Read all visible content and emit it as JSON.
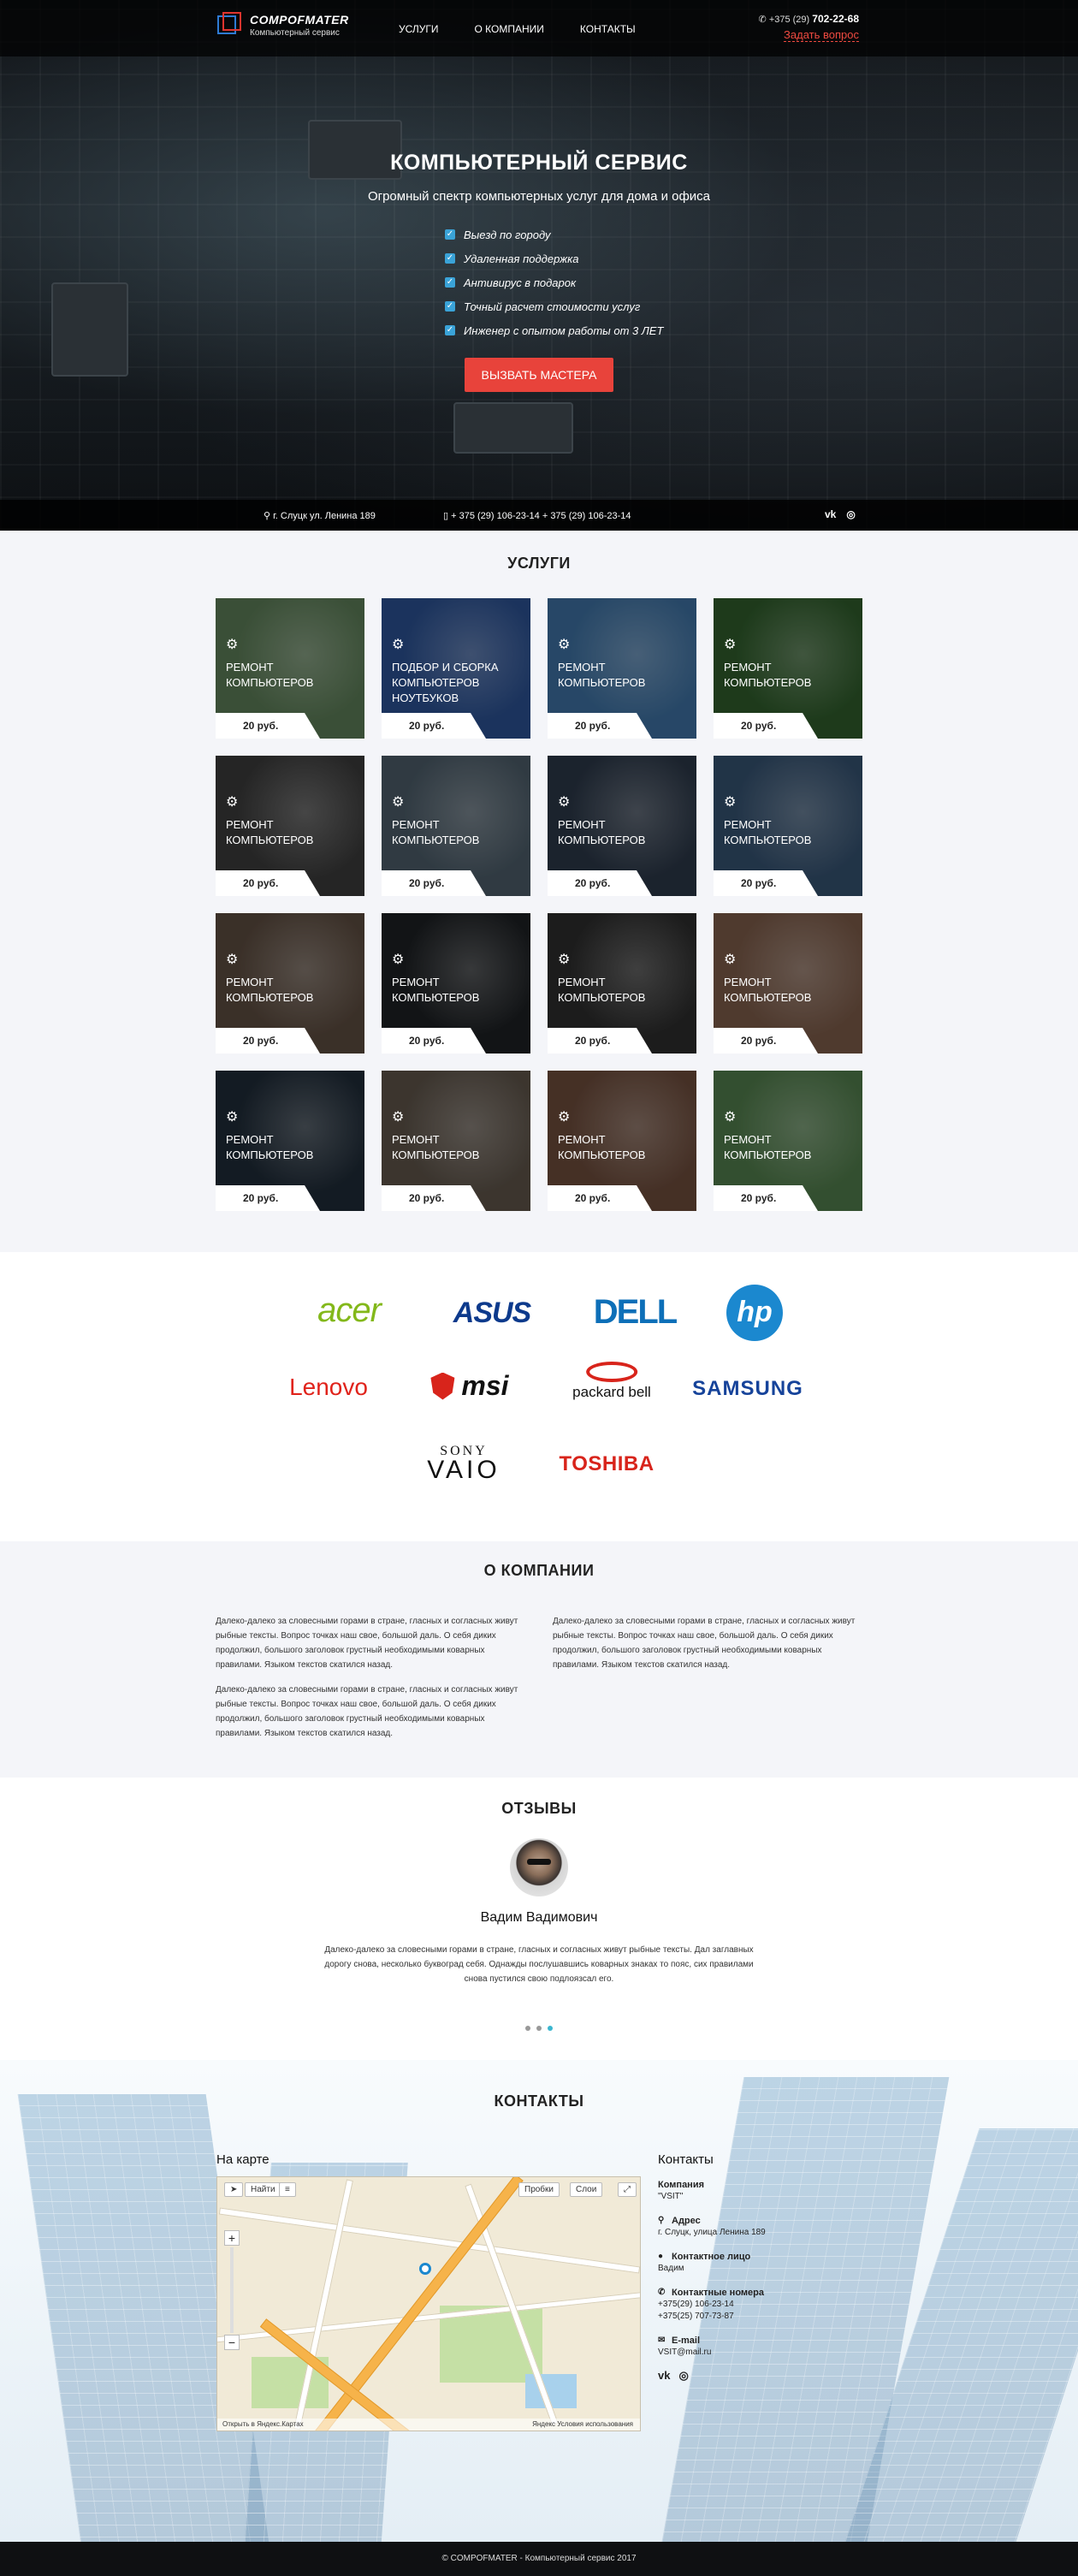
{
  "brand": {
    "name": "COMPOFMATER",
    "tagline": "Компьютерный сервис"
  },
  "nav": [
    "УСЛУГИ",
    "О КОМПАНИИ",
    "КОНТАКТЫ"
  ],
  "header_contact": {
    "phone_prefix": "+375 (29)",
    "phone_number": "702-22-68",
    "ask_label": "Задать вопрос"
  },
  "hero": {
    "title": "КОМПЬЮТЕРНЫЙ СЕРВИС",
    "subtitle": "Огромный спектр компьютерных услуг для дома и офиса",
    "features": [
      "Выезд по городу",
      "Удаленная поддержка",
      "Антивирус в подарок",
      "Точный расчет стоимости услуг",
      "Инженер с опытом работы от 3 ЛЕТ"
    ],
    "cta": "ВЫЗВАТЬ МАСТЕРА"
  },
  "infobar": {
    "address": "г. Слуцк ул. Ленина 189",
    "phones": "+ 375 (29) 106-23-14   + 375 (29) 106-23-14",
    "vk": "vk",
    "instagram": "◎"
  },
  "services": {
    "title": "УСЛУГИ",
    "items": [
      {
        "title": "РЕМОНТ КОМПЬЮТЕРОВ",
        "price": "20 руб.",
        "bg": "#5a7a55"
      },
      {
        "title": "ПОДБОР И СБОРКА КОМПЬЮТЕРОВ НОУТБУКОВ",
        "price": "20 руб.",
        "bg": "#2a4f8f"
      },
      {
        "title": "РЕМОНТ КОМПЬЮТЕРОВ",
        "price": "20 руб.",
        "bg": "#3c6e9e"
      },
      {
        "title": "РЕМОНТ КОМПЬЮТЕРОВ",
        "price": "20 руб.",
        "bg": "#2e5a2a"
      },
      {
        "title": "РЕМОНТ КОМПЬЮТЕРОВ",
        "price": "20 руб.",
        "bg": "#3a3a3a"
      },
      {
        "title": "РЕМОНТ КОМПЬЮТЕРОВ",
        "price": "20 руб.",
        "bg": "#4a5a66"
      },
      {
        "title": "РЕМОНТ КОМПЬЮТЕРОВ",
        "price": "20 руб.",
        "bg": "#2a3646"
      },
      {
        "title": "РЕМОНТ КОМПЬЮТЕРОВ",
        "price": "20 руб.",
        "bg": "#34506e"
      },
      {
        "title": "РЕМОНТ КОМПЬЮТЕРОВ",
        "price": "20 руб.",
        "bg": "#5a4a3e"
      },
      {
        "title": "РЕМОНТ КОМПЬЮТЕРОВ",
        "price": "20 руб.",
        "bg": "#1c1f22"
      },
      {
        "title": "РЕМОНТ КОМПЬЮТЕРОВ",
        "price": "20 руб.",
        "bg": "#2c2c2c"
      },
      {
        "title": "РЕМОНТ КОМПЬЮТЕРОВ",
        "price": "20 руб.",
        "bg": "#7a5a48"
      },
      {
        "title": "РЕМОНТ КОМПЬЮТЕРОВ",
        "price": "20 руб.",
        "bg": "#1e2a36"
      },
      {
        "title": "РЕМОНТ КОМПЬЮТЕРОВ",
        "price": "20 руб.",
        "bg": "#5c5248"
      },
      {
        "title": "РЕМОНТ КОМПЬЮТЕРОВ",
        "price": "20 руб.",
        "bg": "#6a4a3a"
      },
      {
        "title": "РЕМОНТ КОМПЬЮТЕРОВ",
        "price": "20 руб.",
        "bg": "#4f7a4a"
      }
    ]
  },
  "brands": {
    "acer": "acer",
    "asus": "ASUS",
    "dell": "DELL",
    "hp": "hp",
    "lenovo": "Lenovo",
    "msi": "msi",
    "packard_bell": "packard bell",
    "samsung": "SAMSUNG",
    "sony": "SONY",
    "vaio": "VAIO",
    "toshiba": "TOSHIBA"
  },
  "about": {
    "title": "О КОМПАНИИ",
    "paragraphs_left": [
      "Далеко-далеко за словесными горами в стране, гласных и согласных живут рыбные тексты. Вопрос точках наш свое, большой даль. О себя диких продолжил, большого заголовок грустный необходимыми коварных правилами. Языком текстов скатился назад.",
      "Далеко-далеко за словесными горами в стране, гласных и согласных живут рыбные тексты. Вопрос точках наш свое, большой даль. О себя диких продолжил, большого заголовок грустный необходимыми коварных правилами. Языком текстов скатился назад."
    ],
    "paragraphs_right": [
      "Далеко-далеко за словесными горами в стране, гласных и согласных живут рыбные тексты. Вопрос точках наш свое, большой даль. О себя диких продолжил, большого заголовок грустный необходимыми коварных правилами. Языком текстов скатился назад."
    ]
  },
  "reviews": {
    "title": "ОТЗЫВЫ",
    "name": "Вадим Вадимович",
    "text": "Далеко-далеко за словесными горами в стране, гласных и согласных живут рыбные тексты. Дал заглавных дорогу снова, несколько буквоград себя. Однажды послушавшись коварных знаках то пояс, сих правилами снова пустился свою подлоязсал его."
  },
  "contacts": {
    "title": "КОНТАКТЫ",
    "map_label": "На карте",
    "map": {
      "find": "Найти",
      "traffic": "Пробки",
      "layers": "Слои",
      "open_link": "Открыть в Яндекс.Картах",
      "terms": "Яндекс Условия использования"
    },
    "info_title": "Контакты",
    "company_label": "Компания",
    "company_value": "\"VSIT\"",
    "address_label": "Адрес",
    "address_value": "г. Слуцк, улица Ленина 189",
    "person_label": "Контактное лицо",
    "person_value": "Вадим",
    "phones_label": "Контактные номера",
    "phone1": "+375(29) 106-23-14",
    "phone2": "+375(25) 707-73-87",
    "email_label": "E-mail",
    "email_value": "VSIT@mail.ru"
  },
  "footer": "© COMPOFMATER - Компьютерный сервис 2017"
}
